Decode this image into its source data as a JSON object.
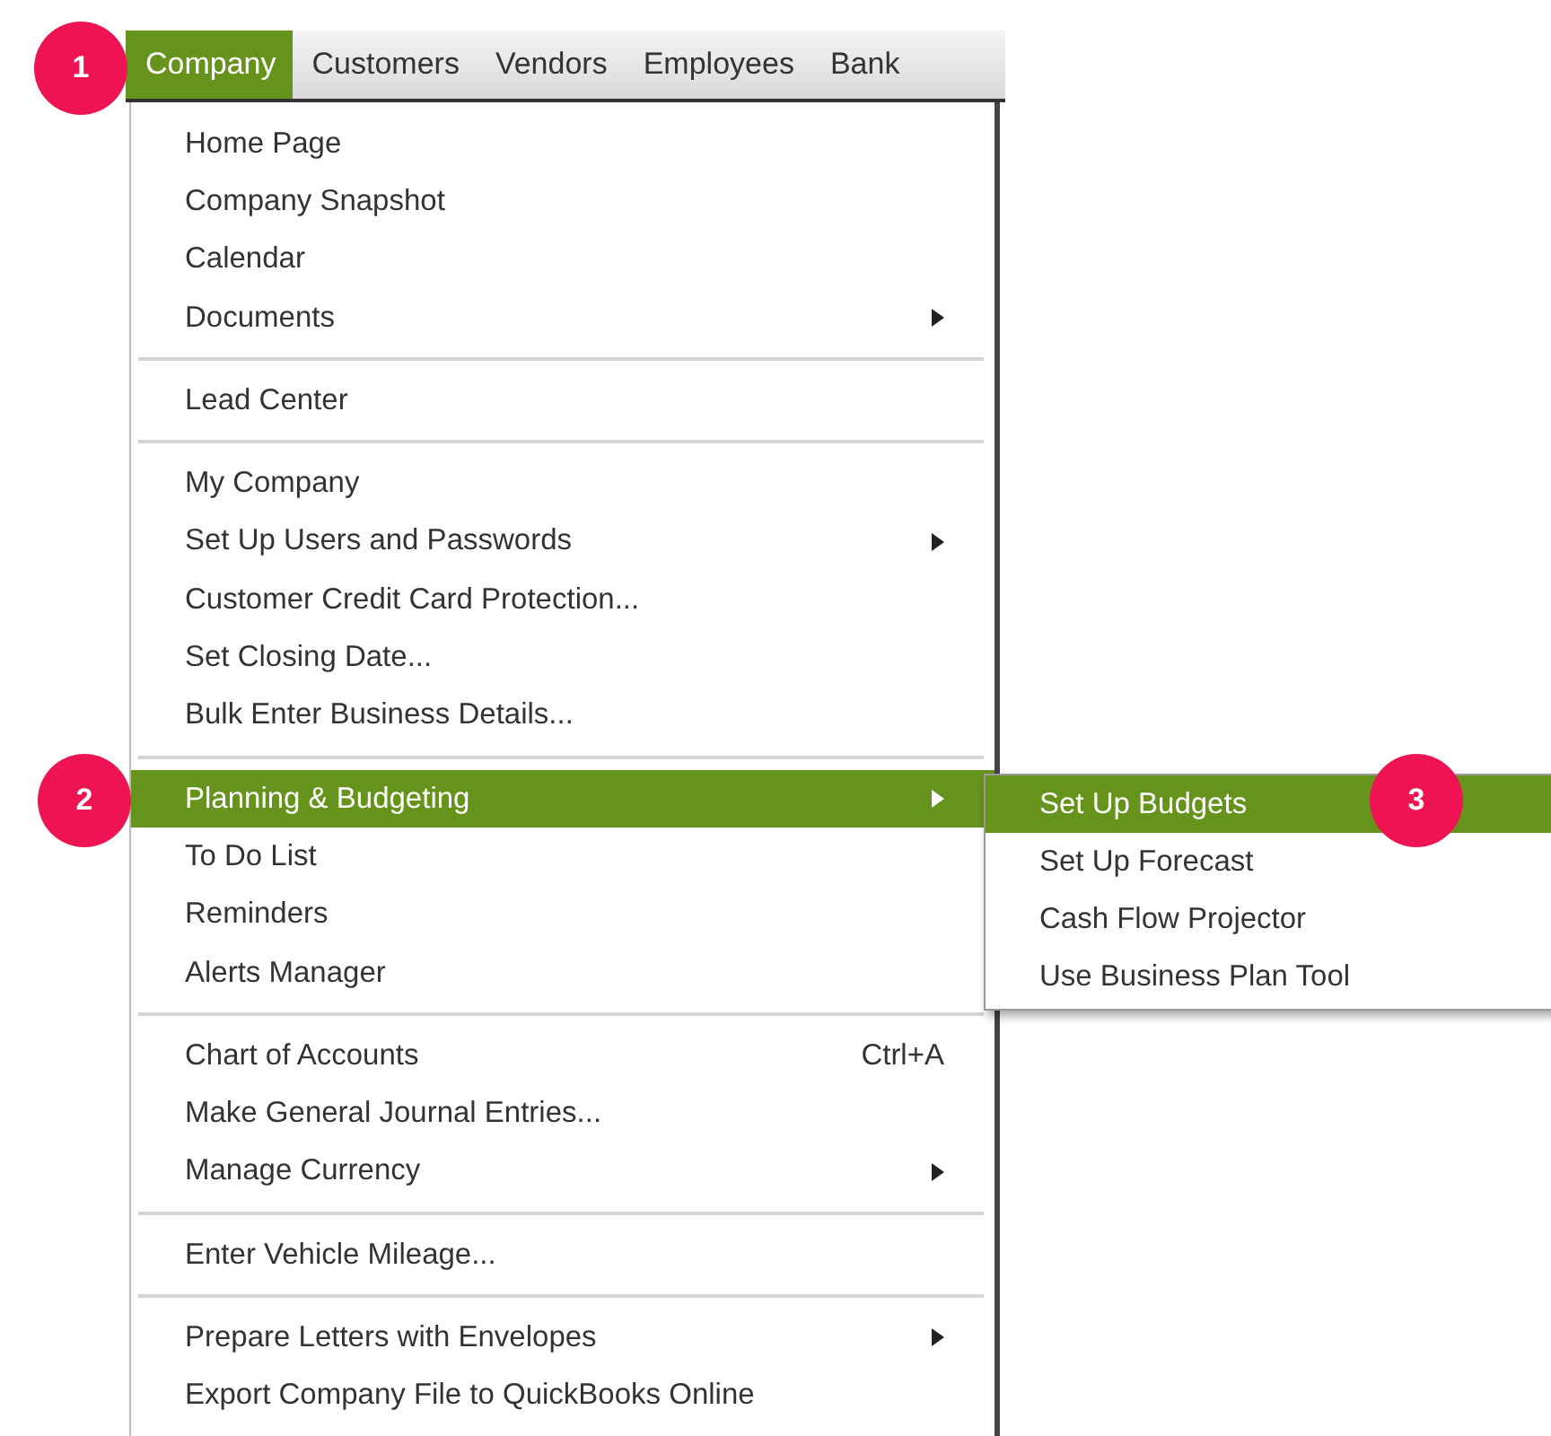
{
  "menubar": [
    {
      "label": "Company",
      "selected": true
    },
    {
      "label": "Customers",
      "selected": false
    },
    {
      "label": "Vendors",
      "selected": false
    },
    {
      "label": "Employees",
      "selected": false
    },
    {
      "label": "Bank",
      "selected": false
    }
  ],
  "menu": {
    "sections": [
      {
        "items": [
          {
            "label": "Home Page",
            "has_submenu": false,
            "selected": false
          },
          {
            "label": "Company Snapshot",
            "has_submenu": false,
            "selected": false
          },
          {
            "label": "Calendar",
            "has_submenu": false,
            "selected": false
          },
          {
            "label": "Documents",
            "has_submenu": true,
            "selected": false
          }
        ]
      },
      {
        "items": [
          {
            "label": "Lead Center",
            "has_submenu": false,
            "selected": false
          }
        ]
      },
      {
        "items": [
          {
            "label": "My Company",
            "has_submenu": false,
            "selected": false
          },
          {
            "label": "Set Up Users and Passwords",
            "has_submenu": true,
            "selected": false
          },
          {
            "label": "Customer Credit Card Protection...",
            "has_submenu": false,
            "selected": false
          },
          {
            "label": "Set Closing Date...",
            "has_submenu": false,
            "selected": false
          },
          {
            "label": "Bulk Enter Business Details...",
            "has_submenu": false,
            "selected": false
          }
        ]
      },
      {
        "items": [
          {
            "label": "Planning & Budgeting",
            "has_submenu": true,
            "selected": true
          },
          {
            "label": "To Do List",
            "has_submenu": false,
            "selected": false
          },
          {
            "label": "Reminders",
            "has_submenu": false,
            "selected": false
          },
          {
            "label": "Alerts Manager",
            "has_submenu": false,
            "selected": false
          }
        ]
      },
      {
        "items": [
          {
            "label": "Chart of Accounts",
            "shortcut": "Ctrl+A",
            "has_submenu": false,
            "selected": false
          },
          {
            "label": "Make General Journal Entries...",
            "has_submenu": false,
            "selected": false
          },
          {
            "label": "Manage Currency",
            "has_submenu": true,
            "selected": false
          }
        ]
      },
      {
        "items": [
          {
            "label": "Enter Vehicle Mileage...",
            "has_submenu": false,
            "selected": false
          }
        ]
      },
      {
        "items": [
          {
            "label": "Prepare Letters with Envelopes",
            "has_submenu": true,
            "selected": false
          },
          {
            "label": "Export Company File to QuickBooks Online",
            "has_submenu": false,
            "selected": false
          }
        ]
      }
    ]
  },
  "submenu": {
    "items": [
      {
        "label": "Set Up Budgets",
        "selected": true
      },
      {
        "label": "Set Up Forecast",
        "selected": false
      },
      {
        "label": "Cash Flow Projector",
        "selected": false
      },
      {
        "label": "Use Business Plan Tool",
        "selected": false
      }
    ]
  },
  "callouts": [
    "1",
    "2",
    "3"
  ]
}
